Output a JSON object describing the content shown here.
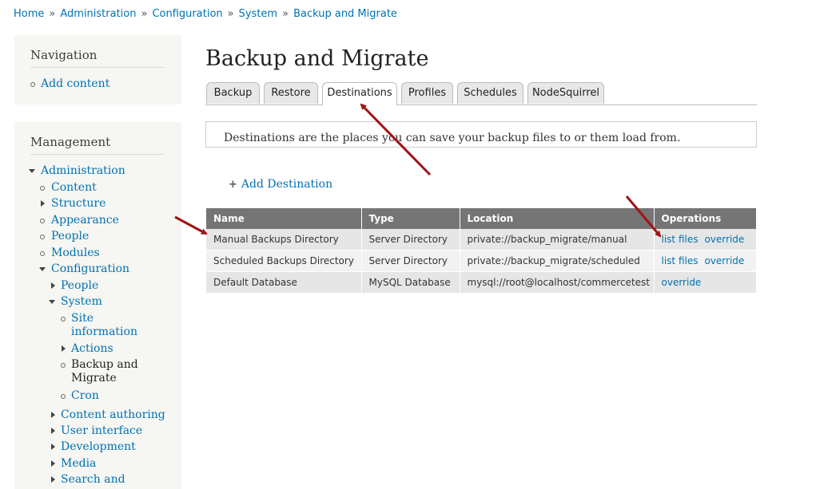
{
  "breadcrumb": {
    "items": [
      "Home",
      "Administration",
      "Configuration",
      "System",
      "Backup and Migrate"
    ],
    "separator": "»"
  },
  "navigation_block": {
    "title": "Navigation",
    "items": [
      "Add content"
    ]
  },
  "management_block": {
    "title": "Management",
    "items": {
      "administration": "Administration",
      "content": "Content",
      "structure": "Structure",
      "appearance": "Appearance",
      "people": "People",
      "modules": "Modules",
      "configuration": "Configuration",
      "config_people": "People",
      "system": "System",
      "site_information_1": "Site",
      "site_information_2": "information",
      "actions": "Actions",
      "backup_migrate_1": "Backup and",
      "backup_migrate_2": "Migrate",
      "cron": "Cron",
      "content_authoring": "Content authoring",
      "user_interface": "User interface",
      "development": "Development",
      "media": "Media",
      "search_and": "Search and"
    }
  },
  "page": {
    "title": "Backup and Migrate",
    "tabs": [
      "Backup",
      "Restore",
      "Destinations",
      "Profiles",
      "Schedules",
      "NodeSquirrel"
    ],
    "active_tab": "Destinations",
    "intro": "Destinations are the places you can save your backup files to or them load from.",
    "add_destination": "Add Destination"
  },
  "table": {
    "headers": [
      "Name",
      "Type",
      "Location",
      "Operations"
    ],
    "rows": [
      {
        "name": "Manual Backups Directory",
        "type": "Server Directory",
        "location": "private://backup_migrate/manual",
        "ops": [
          "list files",
          "override"
        ]
      },
      {
        "name": "Scheduled Backups Directory",
        "type": "Server Directory",
        "location": "private://backup_migrate/scheduled",
        "ops": [
          "list files",
          "override"
        ]
      },
      {
        "name": "Default Database",
        "type": "MySQL Database",
        "location": "mysql://root@localhost/commercetest",
        "ops": [
          "override"
        ]
      }
    ]
  },
  "colors": {
    "link": "#0071b3",
    "table_header": "#757575",
    "annotation_arrow": "#a01414",
    "sidebar_bg": "#f6f6f2"
  }
}
